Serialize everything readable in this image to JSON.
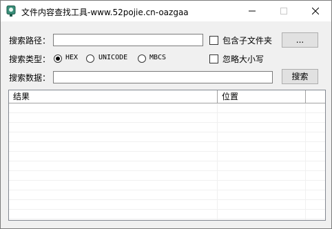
{
  "window": {
    "title": "文件内容查找工具-www.52pojie.cn-oazgaa"
  },
  "form": {
    "path_label": "搜索路径：",
    "path_value": "",
    "include_subfolders_label": "包含子文件夹",
    "include_subfolders_checked": false,
    "browse_button": "...",
    "type_label": "搜索类型：",
    "type_options": [
      "HEX",
      "UNICODE",
      "MBCS"
    ],
    "type_selected": "HEX",
    "ignore_case_label": "忽略大小写",
    "ignore_case_checked": false,
    "data_label": "搜索数据：",
    "data_value": "",
    "search_button": "搜索"
  },
  "results": {
    "columns": [
      "结果",
      "位置"
    ],
    "rows": []
  }
}
